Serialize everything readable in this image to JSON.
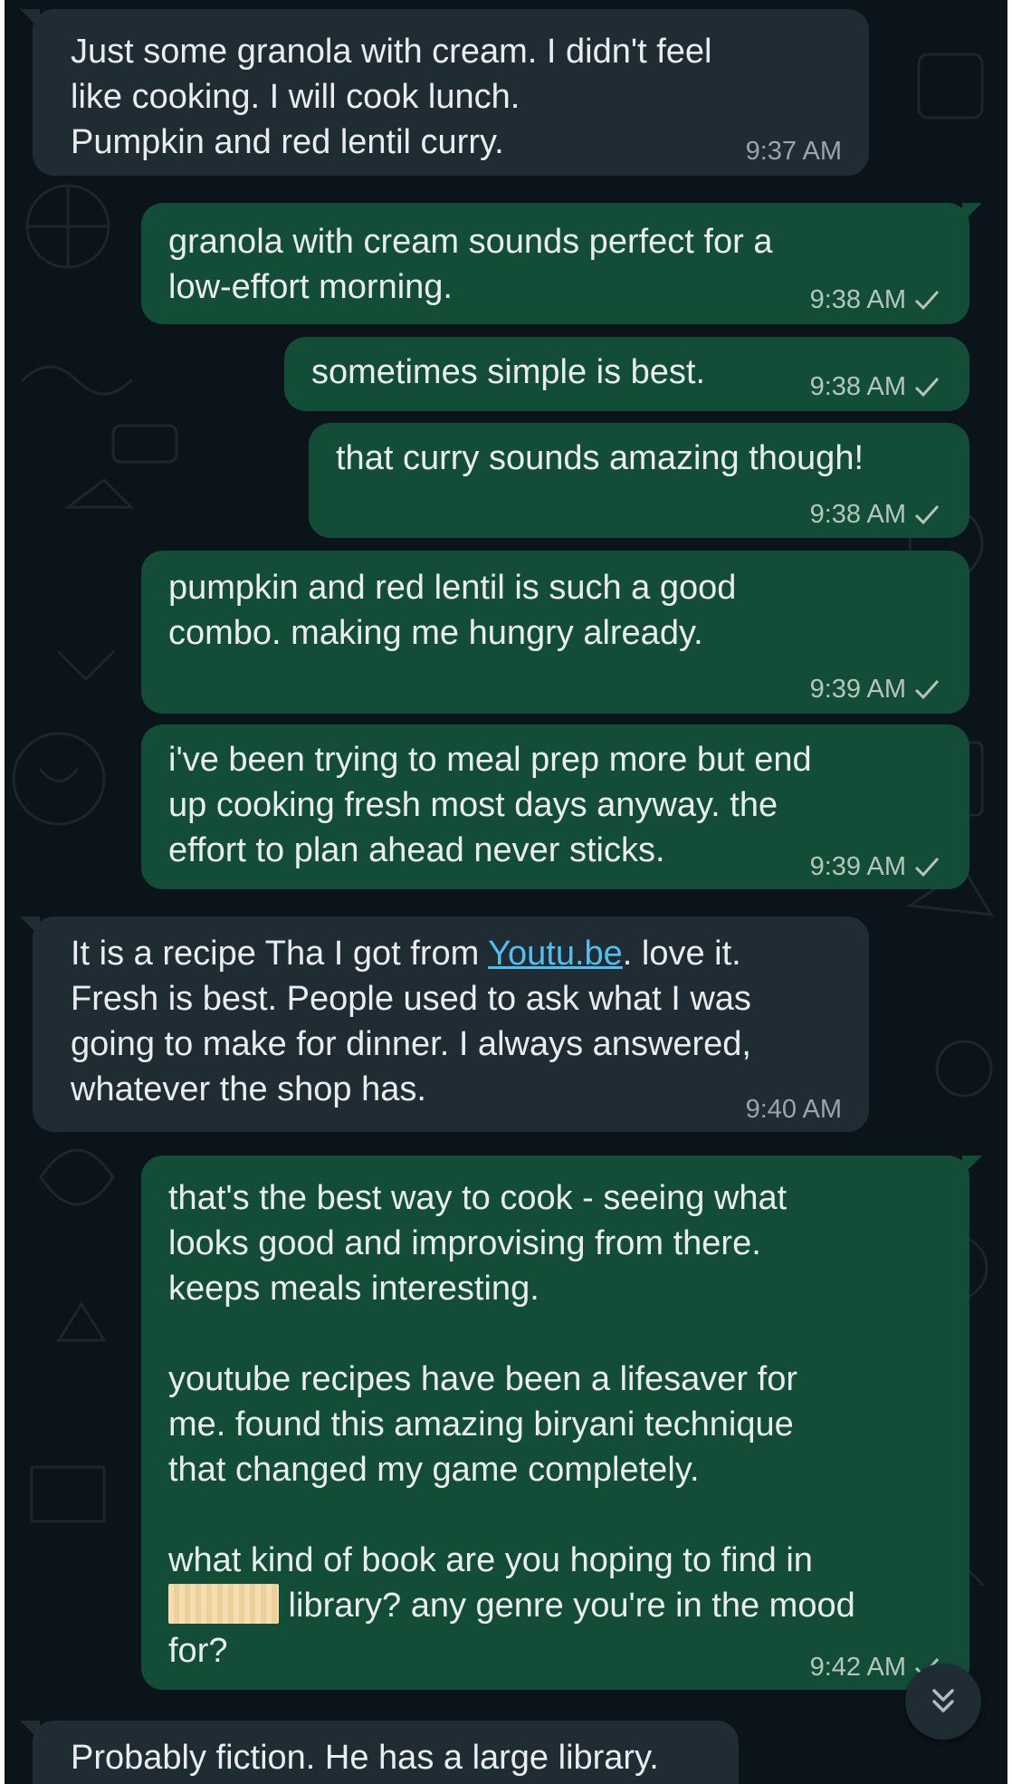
{
  "messages": [
    {
      "id": "m1",
      "direction": "incoming",
      "lines": [
        "Just some granola with cream. I didn't feel",
        "like cooking. I will cook lunch.",
        "Pumpkin and red lentil curry."
      ],
      "time": "9:37 AM"
    },
    {
      "id": "m2",
      "direction": "outgoing",
      "lines": [
        "granola with cream sounds perfect for a",
        "low-effort morning."
      ],
      "time": "9:38 AM",
      "status": "sent-check"
    },
    {
      "id": "m3",
      "direction": "outgoing",
      "lines": [
        "sometimes simple is best."
      ],
      "time": "9:38 AM",
      "status": "sent-check"
    },
    {
      "id": "m4",
      "direction": "outgoing",
      "lines": [
        "that curry sounds amazing though!"
      ],
      "time": "9:38 AM",
      "status": "sent-check"
    },
    {
      "id": "m5",
      "direction": "outgoing",
      "lines": [
        "pumpkin and red lentil is such a good",
        "combo. making me hungry already."
      ],
      "time": "9:39 AM",
      "status": "sent-check"
    },
    {
      "id": "m6",
      "direction": "outgoing",
      "lines": [
        "i've been trying to meal prep more but end",
        "up cooking fresh most days anyway. the",
        "effort to plan ahead never sticks."
      ],
      "time": "9:39 AM",
      "status": "sent-check"
    },
    {
      "id": "m7",
      "direction": "incoming",
      "line1_before": "It is a recipe Tha I got from ",
      "link": "Youtu.be",
      "line1_after": ".  love it.",
      "lines": [
        "Fresh is best. People used to ask what I was",
        "going to make for dinner. I always answered,",
        "whatever the shop has."
      ],
      "time": "9:40 AM"
    },
    {
      "id": "m8",
      "direction": "outgoing",
      "lines": [
        "that's the best way to cook - seeing what",
        "looks good and improvising from there.",
        "keeps meals interesting.",
        "",
        "youtube recipes have been a lifesaver for",
        "me. found this amazing biryani technique",
        "that changed my game completely.",
        "",
        "what kind of book are you hoping to find in"
      ],
      "redacted_line_after": " library? any genre you're in the mood",
      "final_line": "for?",
      "time": "9:42 AM",
      "status": "sent-check"
    },
    {
      "id": "m9",
      "direction": "incoming",
      "lines": [
        "Probably fiction. He has a large library."
      ]
    }
  ],
  "scroll_button_icon": "double-chevron-down-icon",
  "colors": {
    "background": "#0b141a",
    "incoming_bubble": "#202c33",
    "outgoing_bubble": "#144d37",
    "link": "#53bdeb",
    "text": "#e9edef"
  }
}
